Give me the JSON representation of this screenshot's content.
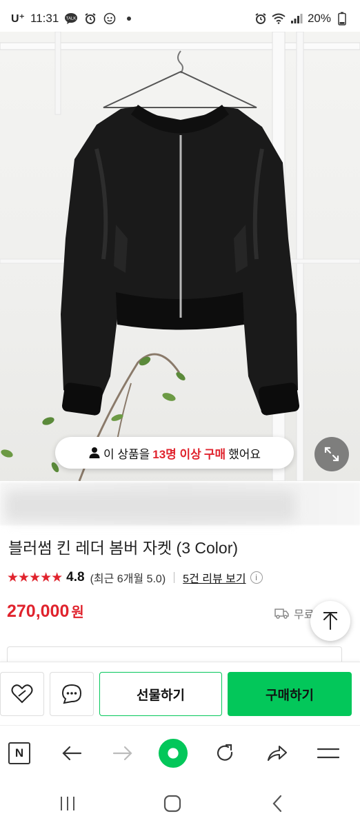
{
  "status_bar": {
    "carrier": "U⁺",
    "time": "11:31",
    "battery": "20%"
  },
  "product": {
    "purchase_badge": {
      "prefix": "이 상품을",
      "count": "13명 이상",
      "action": "구매",
      "suffix": "했어요"
    },
    "title": "블러썸 킨 레더 봄버 자켓 (3 Color)",
    "rating": {
      "stars": "★★★★★",
      "value": "4.8",
      "recent": "(최근 6개월 5.0)",
      "review_link": "5건 리뷰 보기",
      "info": "i"
    },
    "price": "270,000",
    "currency": "원",
    "shipping": "무료"
  },
  "actions": {
    "gift_label": "선물하기",
    "buy_label": "구매하기"
  },
  "browser": {
    "home_label": "N"
  },
  "colors": {
    "accent_green": "#03c75a",
    "price_red": "#e0232d"
  }
}
